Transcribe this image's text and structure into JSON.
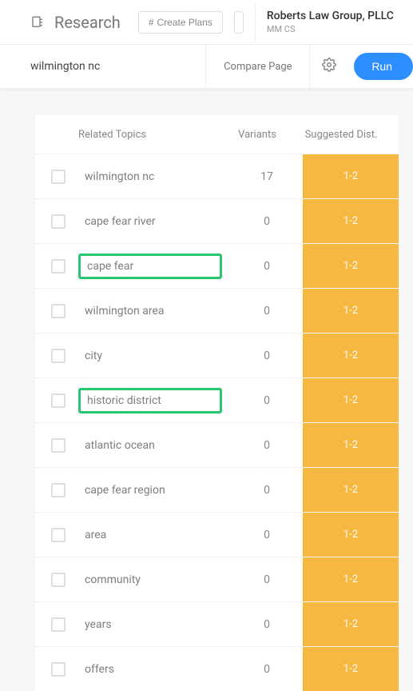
{
  "header": {
    "title": "Research",
    "create_plans_label": "Create Plans",
    "org_name": "Roberts Law Group, PLLC",
    "org_sub": "MM CS"
  },
  "subheader": {
    "search_value": "wilmington nc",
    "compare_label": "Compare Page",
    "run_label": "Run"
  },
  "table": {
    "cols": {
      "topics": "Related Topics",
      "variants": "Variants",
      "dist": "Suggested Dist."
    },
    "rows": [
      {
        "topic": "wilmington nc",
        "variants": "17",
        "dist": "1-2",
        "hl": false
      },
      {
        "topic": "cape fear river",
        "variants": "0",
        "dist": "1-2",
        "hl": false
      },
      {
        "topic": "cape fear",
        "variants": "0",
        "dist": "1-2",
        "hl": true
      },
      {
        "topic": "wilmington area",
        "variants": "0",
        "dist": "1-2",
        "hl": false
      },
      {
        "topic": "city",
        "variants": "0",
        "dist": "1-2",
        "hl": false
      },
      {
        "topic": "historic district",
        "variants": "0",
        "dist": "1-2",
        "hl": true
      },
      {
        "topic": "atlantic ocean",
        "variants": "0",
        "dist": "1-2",
        "hl": false
      },
      {
        "topic": "cape fear region",
        "variants": "0",
        "dist": "1-2",
        "hl": false
      },
      {
        "topic": "area",
        "variants": "0",
        "dist": "1-2",
        "hl": false
      },
      {
        "topic": "community",
        "variants": "0",
        "dist": "1-2",
        "hl": false
      },
      {
        "topic": "years",
        "variants": "0",
        "dist": "1-2",
        "hl": false
      },
      {
        "topic": "offers",
        "variants": "0",
        "dist": "1-2",
        "hl": false
      }
    ]
  }
}
